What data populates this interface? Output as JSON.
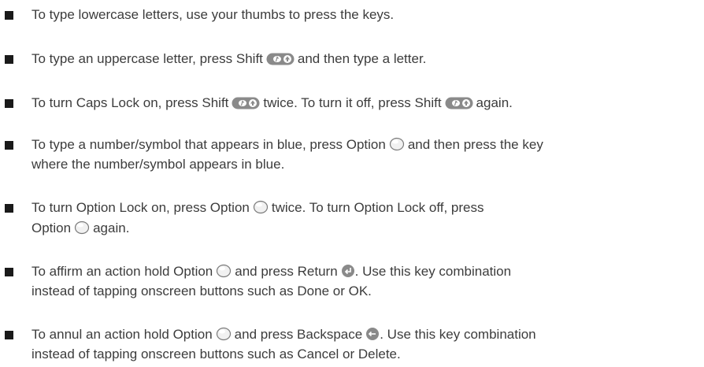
{
  "items": [
    {
      "parts": {
        "t1": "To type lowercase letters, use your thumbs to press the keys."
      }
    },
    {
      "parts": {
        "t1": "To type an uppercase letter, press Shift",
        "t2": "and then type a letter."
      }
    },
    {
      "parts": {
        "t1": "To turn Caps Lock on, press Shift",
        "t2": "twice. To turn it off, press Shift",
        "t3": "again."
      }
    },
    {
      "parts": {
        "t1": "To type a number/symbol that appears in blue, press Option",
        "t2": "and then press the key",
        "t3": "where the number/symbol appears in blue."
      }
    },
    {
      "parts": {
        "t1": "To turn Option Lock on, press Option",
        "t2": "twice. To turn Option Lock off, press",
        "t3": "Option",
        "t4": "again."
      }
    },
    {
      "parts": {
        "t1": "To affirm an action hold Option",
        "t2": "and press Return",
        "t3": ". Use this key combination",
        "t4": "instead of tapping onscreen buttons such as Done or OK."
      }
    },
    {
      "parts": {
        "t1": "To annul an action hold Option",
        "t2": "and press Backspace",
        "t3": ". Use this key combination",
        "t4": "instead of tapping onscreen buttons such as Cancel or Delete."
      }
    }
  ],
  "icons": {
    "shift": "shift-key-icon",
    "option": "option-key-icon",
    "return": "return-key-icon",
    "backspace": "backspace-key-icon"
  }
}
